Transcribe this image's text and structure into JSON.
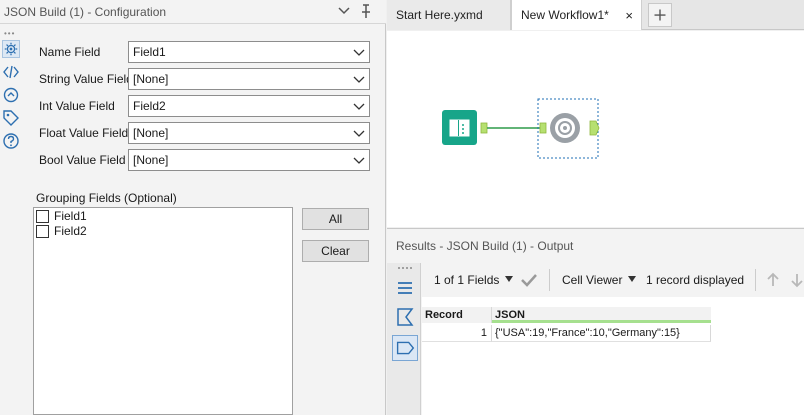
{
  "config": {
    "title": "JSON Build (1) - Configuration",
    "fields": [
      {
        "label": "Name Field",
        "value": "Field1"
      },
      {
        "label": "String Value Field",
        "value": "[None]"
      },
      {
        "label": "Int Value Field",
        "value": "Field2"
      },
      {
        "label": "Float Value Field",
        "value": "[None]"
      },
      {
        "label": "Bool Value Field",
        "value": "[None]"
      }
    ],
    "grouping": {
      "label": "Grouping Fields (Optional)",
      "items": [
        "Field1",
        "Field2"
      ],
      "all_label": "All",
      "clear_label": "Clear"
    }
  },
  "tabs": [
    {
      "label": "Start Here.yxmd"
    },
    {
      "label": "New Workflow1*",
      "close": "×"
    }
  ],
  "tab_add": "+",
  "results": {
    "title": "Results - JSON Build (1) - Output",
    "fields_label": "1 of 1 Fields",
    "viewer_label": "Cell Viewer",
    "records_label": "1 record displayed",
    "columns": [
      "Record",
      "JSON"
    ],
    "rows": [
      {
        "record": "1",
        "json": "{\"USA\":19,\"France\":10,\"Germany\":15}"
      }
    ]
  },
  "colors": {
    "input_tool": "#17a589",
    "json_tool": "#9aa0a6",
    "connector": "#2e9c4a",
    "anchor": "#b6e070",
    "accent": "#1f6fb5"
  }
}
